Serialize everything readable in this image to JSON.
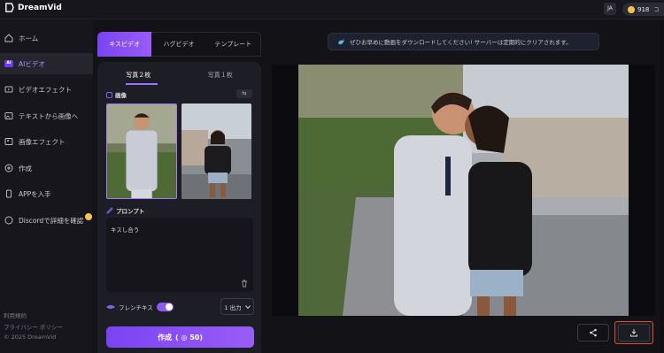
{
  "brand": {
    "name": "DreamVid",
    "logo_icon": "dreamvid-logo-icon"
  },
  "topbar": {
    "lang": "JA",
    "credits": "918",
    "more": "コ"
  },
  "sidebar": {
    "items": [
      {
        "label": "ホーム",
        "icon": "home-icon"
      },
      {
        "label": "AIビデオ",
        "icon": "ai-chip-icon",
        "active": true
      },
      {
        "label": "ビデオエフェクト",
        "icon": "video-effect-icon"
      },
      {
        "label": "テキストから画像へ",
        "icon": "text-to-image-icon"
      },
      {
        "label": "画像エフェクト",
        "icon": "image-effect-icon"
      },
      {
        "label": "作成",
        "icon": "create-icon"
      },
      {
        "label": "APPを入手",
        "icon": "app-icon"
      },
      {
        "label": "Discordで詳細を確認",
        "icon": "discord-icon"
      }
    ],
    "footer": {
      "terms": "利用規約",
      "privacy": "プライバシー ポリシー",
      "copyright": "© 2025 DreamVid"
    }
  },
  "tabs": [
    {
      "label": "キスビデオ",
      "active": true
    },
    {
      "label": "ハグビデオ"
    },
    {
      "label": "テンプレート"
    }
  ],
  "panel": {
    "subtabs": [
      {
        "label": "写真２枚",
        "active": true
      },
      {
        "label": "写真１枚"
      }
    ],
    "image_section": "画像",
    "prompt_section": "プロンプト",
    "prompt_value": "キスし合う",
    "french_kiss_label": "フレンチキス",
    "french_kiss_on": true,
    "output_select": "1 出力",
    "create_button": "作成",
    "create_cost": "( ◎ 50)"
  },
  "notice": "ぜひお早めに動画をダウンロードしてください! サーバーは定期的にクリアされます。",
  "colors": {
    "accent": "#8c5cf0",
    "background": "#121217",
    "highlight": "#e04a2f"
  }
}
